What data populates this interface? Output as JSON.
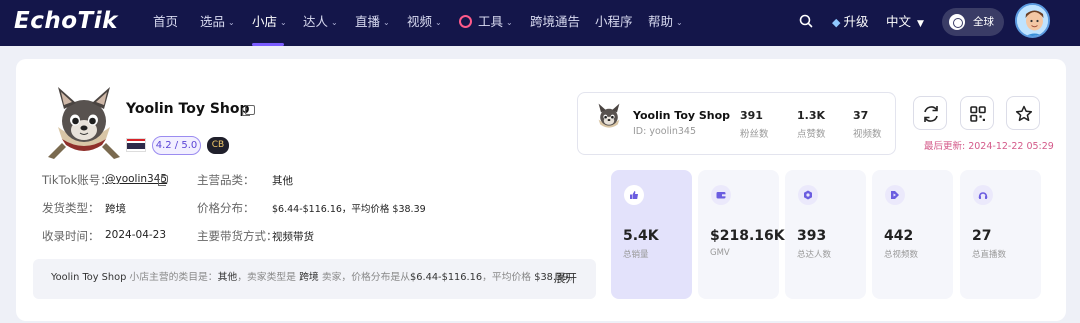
{
  "nav": {
    "logo": "EchoTik",
    "items": [
      {
        "label": "首页"
      },
      {
        "label": "选品",
        "dropdown": true
      },
      {
        "label": "小店",
        "dropdown": true,
        "active": true
      },
      {
        "label": "达人",
        "dropdown": true
      },
      {
        "label": "直播",
        "dropdown": true
      },
      {
        "label": "视频",
        "dropdown": true
      },
      {
        "label": "工具",
        "dropdown": true
      },
      {
        "label": "跨境通告"
      },
      {
        "label": "小程序"
      },
      {
        "label": "帮助",
        "dropdown": true
      }
    ],
    "upgrade": "升级",
    "language": "中文",
    "region": "全球"
  },
  "shop": {
    "name": "Yoolin Toy Shop",
    "rating": "4.2 / 5.0",
    "badge": "CB",
    "country_flag": "thailand-flag",
    "info": {
      "tiktok_label": "TikTok账号：",
      "tiktok_value": "@yoolin345",
      "category_label": "主营品类：",
      "category_value": "其他",
      "ship_label": "发货类型：",
      "ship_value": "跨境",
      "price_label": "价格分布：",
      "price_value": "$6.44-$116.16，平均价格 $38.39",
      "date_label": "收录时间：",
      "date_value": "2024-04-23",
      "mode_label": "主要带货方式：",
      "mode_value": "视频带货"
    },
    "summary": {
      "name": "Yoolin Toy Shop",
      "t1": " 小店主营的类目是：",
      "category": "其他",
      "t2": "，卖家类型是 ",
      "ship": "跨境",
      "t3": " 卖家，价格分布是从",
      "price": "$6.44-$116.16",
      "t4": "，平均价格 ",
      "avg": "$38.39",
      "t5": "。",
      "expand": "展开"
    }
  },
  "mini_card": {
    "name": "Yoolin Toy Shop",
    "id": "ID: yoolin345",
    "stats": [
      {
        "value": "391",
        "label": "粉丝数"
      },
      {
        "value": "1.3K",
        "label": "点赞数"
      },
      {
        "value": "37",
        "label": "视频数"
      }
    ]
  },
  "last_updated": "最后更新: 2024-12-22 05:29",
  "stats": [
    {
      "value": "5.4K",
      "label": "总销量",
      "icon": "thumbs-up-icon"
    },
    {
      "value": "$218.16K",
      "label": "GMV",
      "icon": "wallet-icon"
    },
    {
      "value": "393",
      "label": "总达人数",
      "icon": "creator-icon"
    },
    {
      "value": "442",
      "label": "总视频数",
      "icon": "video-icon"
    },
    {
      "value": "27",
      "label": "总直播数",
      "icon": "live-icon"
    }
  ],
  "colors": {
    "nav_bg": "#14164a",
    "accent": "#7a5cff",
    "updated_text": "#d45a8a",
    "highlight_stat_bg": "#e3e2fb"
  }
}
